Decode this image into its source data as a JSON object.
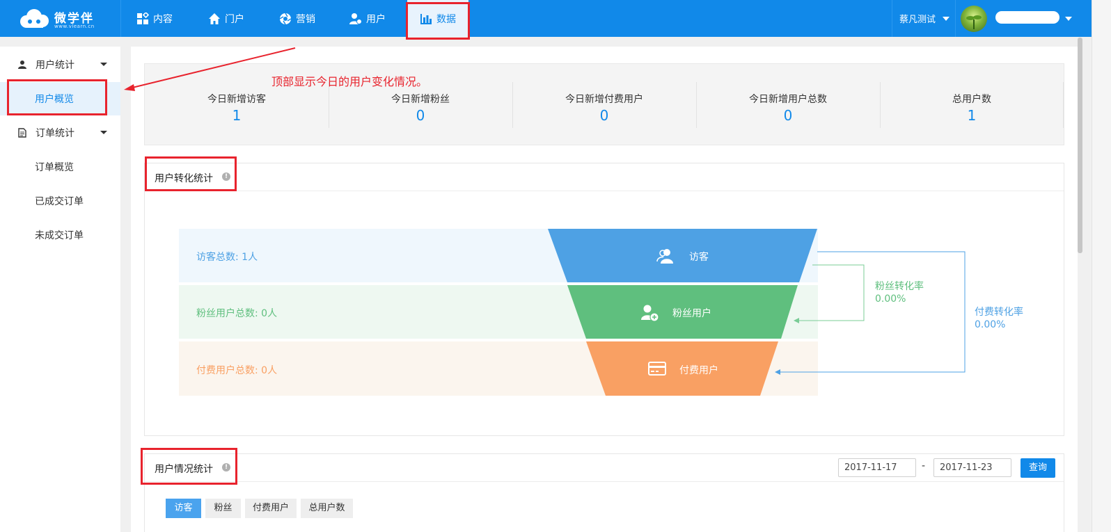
{
  "topbar": {
    "logo": {
      "brand": "微学伴",
      "url": "www.vlearn.cn"
    },
    "nav": [
      {
        "label": "内容",
        "icon": "grid-icon"
      },
      {
        "label": "门户",
        "icon": "home-icon"
      },
      {
        "label": "营销",
        "icon": "aperture-icon"
      },
      {
        "label": "用户",
        "icon": "user-icon"
      },
      {
        "label": "数据",
        "icon": "bar-chart-icon"
      }
    ],
    "account": {
      "shop": "蔡凡测试"
    }
  },
  "sidebar": {
    "groups": [
      {
        "label": "用户统计",
        "icon": "person-icon",
        "items": [
          {
            "label": "用户概览"
          }
        ]
      },
      {
        "label": "订单统计",
        "icon": "document-icon",
        "items": [
          {
            "label": "订单概览"
          },
          {
            "label": "已成交订单"
          },
          {
            "label": "未成交订单"
          }
        ]
      }
    ]
  },
  "annotation": "顶部显示今日的用户变化情况。",
  "stats": [
    {
      "label": "今日新增访客",
      "value": "1"
    },
    {
      "label": "今日新增粉丝",
      "value": "0"
    },
    {
      "label": "今日新增付费用户",
      "value": "0"
    },
    {
      "label": "今日新增用户总数",
      "value": "0"
    },
    {
      "label": "总用户数",
      "value": "1"
    }
  ],
  "conversion": {
    "title": "用户转化统计",
    "rows": [
      {
        "summary": "访客总数: 1人",
        "stage": "访客"
      },
      {
        "summary": "粉丝用户总数: 0人",
        "stage": "粉丝用户"
      },
      {
        "summary": "付费用户总数: 0人",
        "stage": "付费用户"
      }
    ],
    "rates": [
      {
        "label": "粉丝转化率",
        "value": "0.00%"
      },
      {
        "label": "付费转化率",
        "value": "0.00%"
      }
    ]
  },
  "usage": {
    "title": "用户情况统计",
    "date_from": "2017-11-17",
    "date_sep": "-",
    "date_to": "2017-11-23",
    "query_label": "查询",
    "tabs": [
      "访客",
      "粉丝",
      "付费用户",
      "总用户数"
    ]
  },
  "colors": {
    "primary": "#1189e9",
    "visitor": "#4ea1e4",
    "fan": "#5fbf7e",
    "paid": "#f9a063",
    "highlight": "#e8232d"
  }
}
